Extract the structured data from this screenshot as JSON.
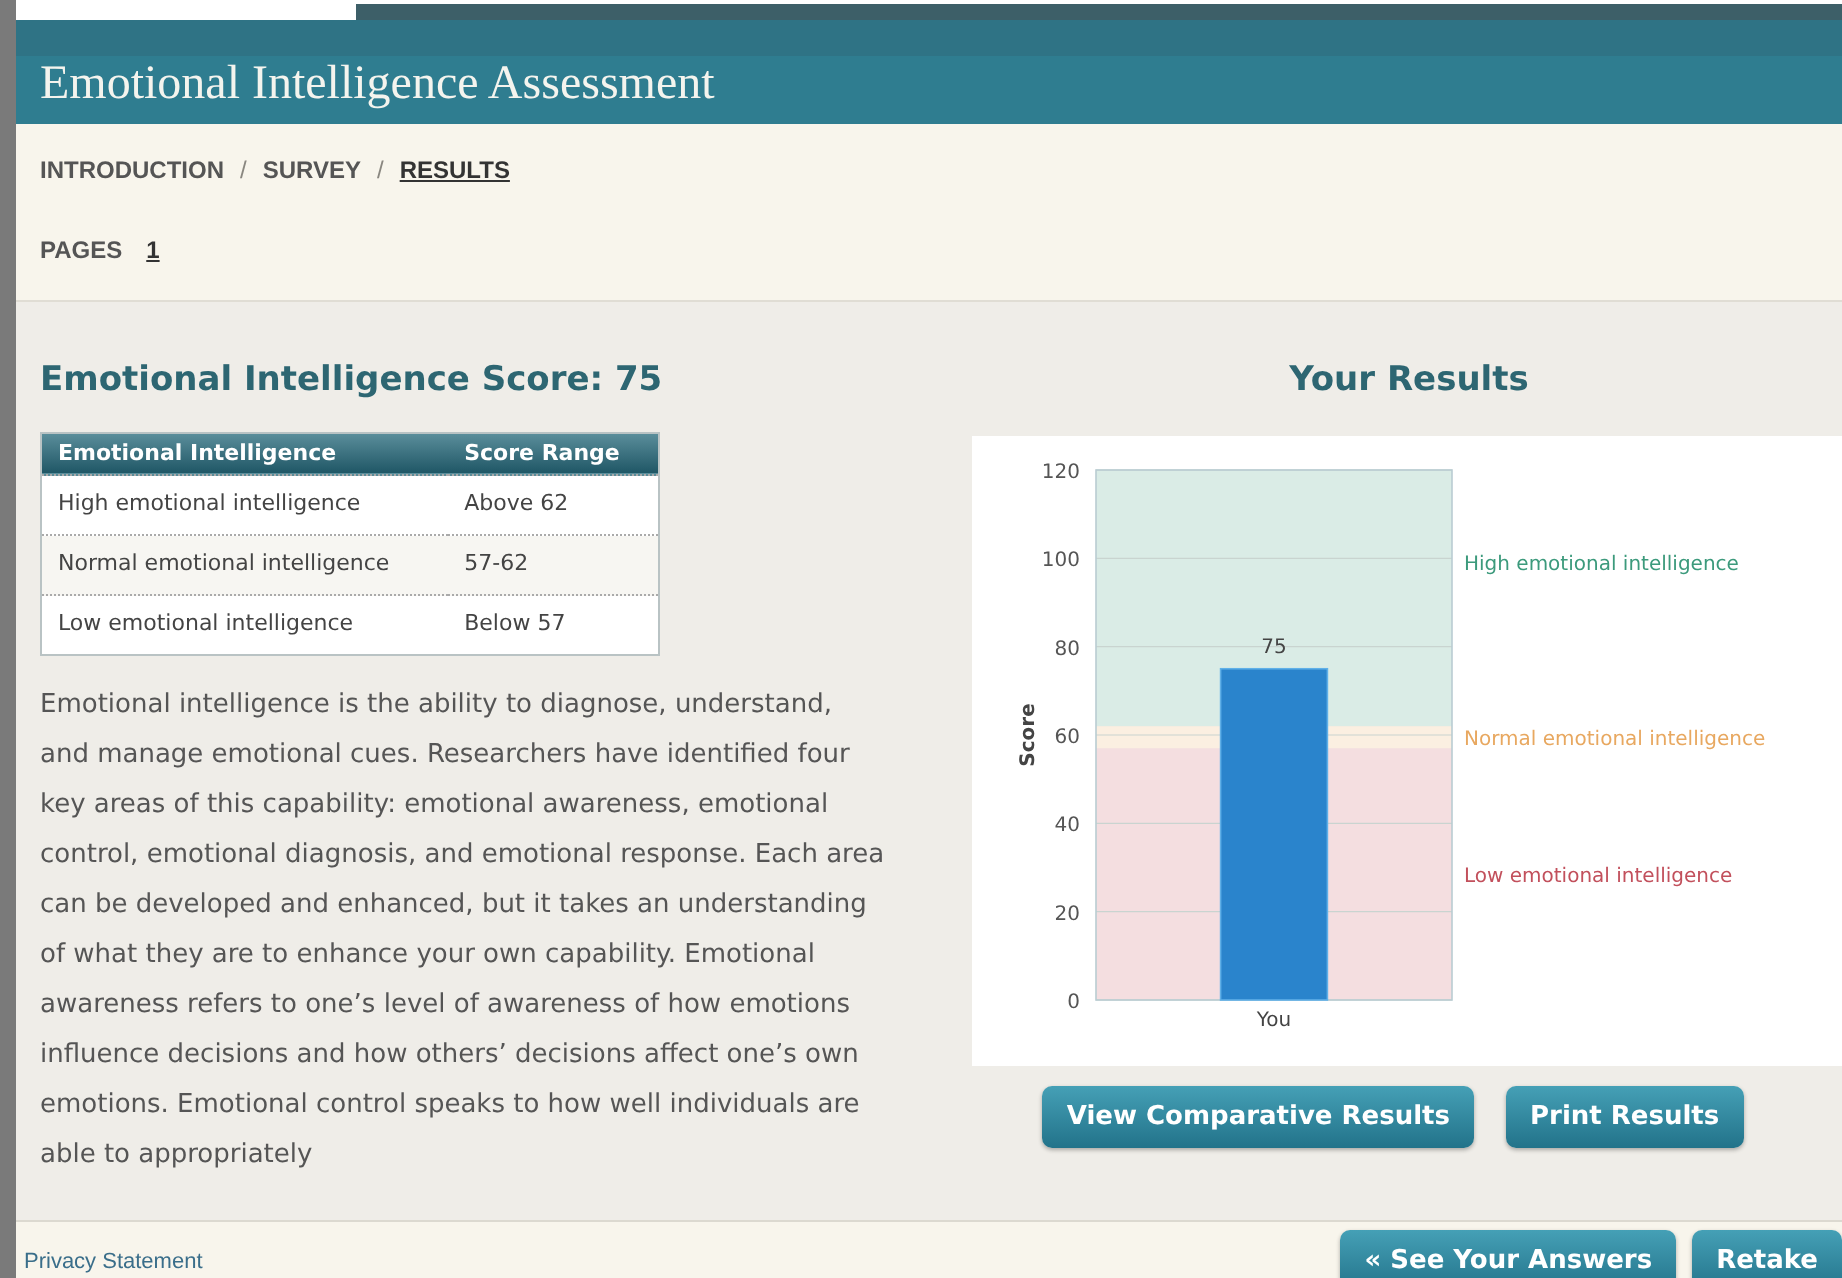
{
  "window": {
    "title": "Emotional Intelligence Assessment"
  },
  "breadcrumbs": [
    {
      "label": "INTRODUCTION",
      "selected": false
    },
    {
      "label": "SURVEY",
      "selected": false
    },
    {
      "label": "RESULTS",
      "selected": true
    }
  ],
  "breadcrumb_separator": "/",
  "pages": {
    "label": "PAGES",
    "items": [
      {
        "label": "1",
        "selected": true
      }
    ]
  },
  "score_heading": "Emotional Intelligence Score: 75",
  "score_table": {
    "columns": [
      "Emotional Intelligence",
      "Score Range"
    ],
    "rows": [
      [
        "High emotional intelligence",
        "Above 62"
      ],
      [
        "Normal emotional intelligence",
        "57-62"
      ],
      [
        "Low emotional intelligence",
        "Below 57"
      ]
    ]
  },
  "description": "Emotional intelligence is the ability to diagnose, understand, and manage emotional cues. Researchers have identified four key areas of this capability: emotional awareness, emotional control, emotional diagnosis, and emotional response. Each area can be developed and enhanced, but it takes an understanding of what they are to enhance your own capability. Emotional awareness refers to one’s level of awareness of how emotions influence decisions and how others’ decisions affect one’s own emotions. Emotional control speaks to how well individuals are able to appropriately",
  "results": {
    "title": "Your Results",
    "chart_data": {
      "type": "bar",
      "ylabel": "Score",
      "categories": [
        "You"
      ],
      "series": [
        {
          "color": "#2a84cc",
          "values": [
            75
          ]
        }
      ],
      "ylim": [
        0,
        120
      ],
      "yticks": [
        0,
        20,
        40,
        60,
        80,
        100,
        120
      ],
      "data_labels": true,
      "grid": true,
      "bands": [
        {
          "axis": "y",
          "label": "High emotional intelligence",
          "from": 62,
          "to": 120,
          "color": "#3c9a7c"
        },
        {
          "axis": "y",
          "label": "Normal emotional intelligence",
          "from": 57,
          "to": 62,
          "color": "#e8a860"
        },
        {
          "axis": "y",
          "label": "Low emotional intelligence",
          "from": 0,
          "to": 57,
          "color": "#c2505c"
        }
      ]
    },
    "buttons": [
      "View Comparative Results",
      "Print Results"
    ]
  },
  "footer": {
    "link": "Privacy Statement",
    "buttons": [
      "« See Your Answers",
      "Retake"
    ]
  }
}
